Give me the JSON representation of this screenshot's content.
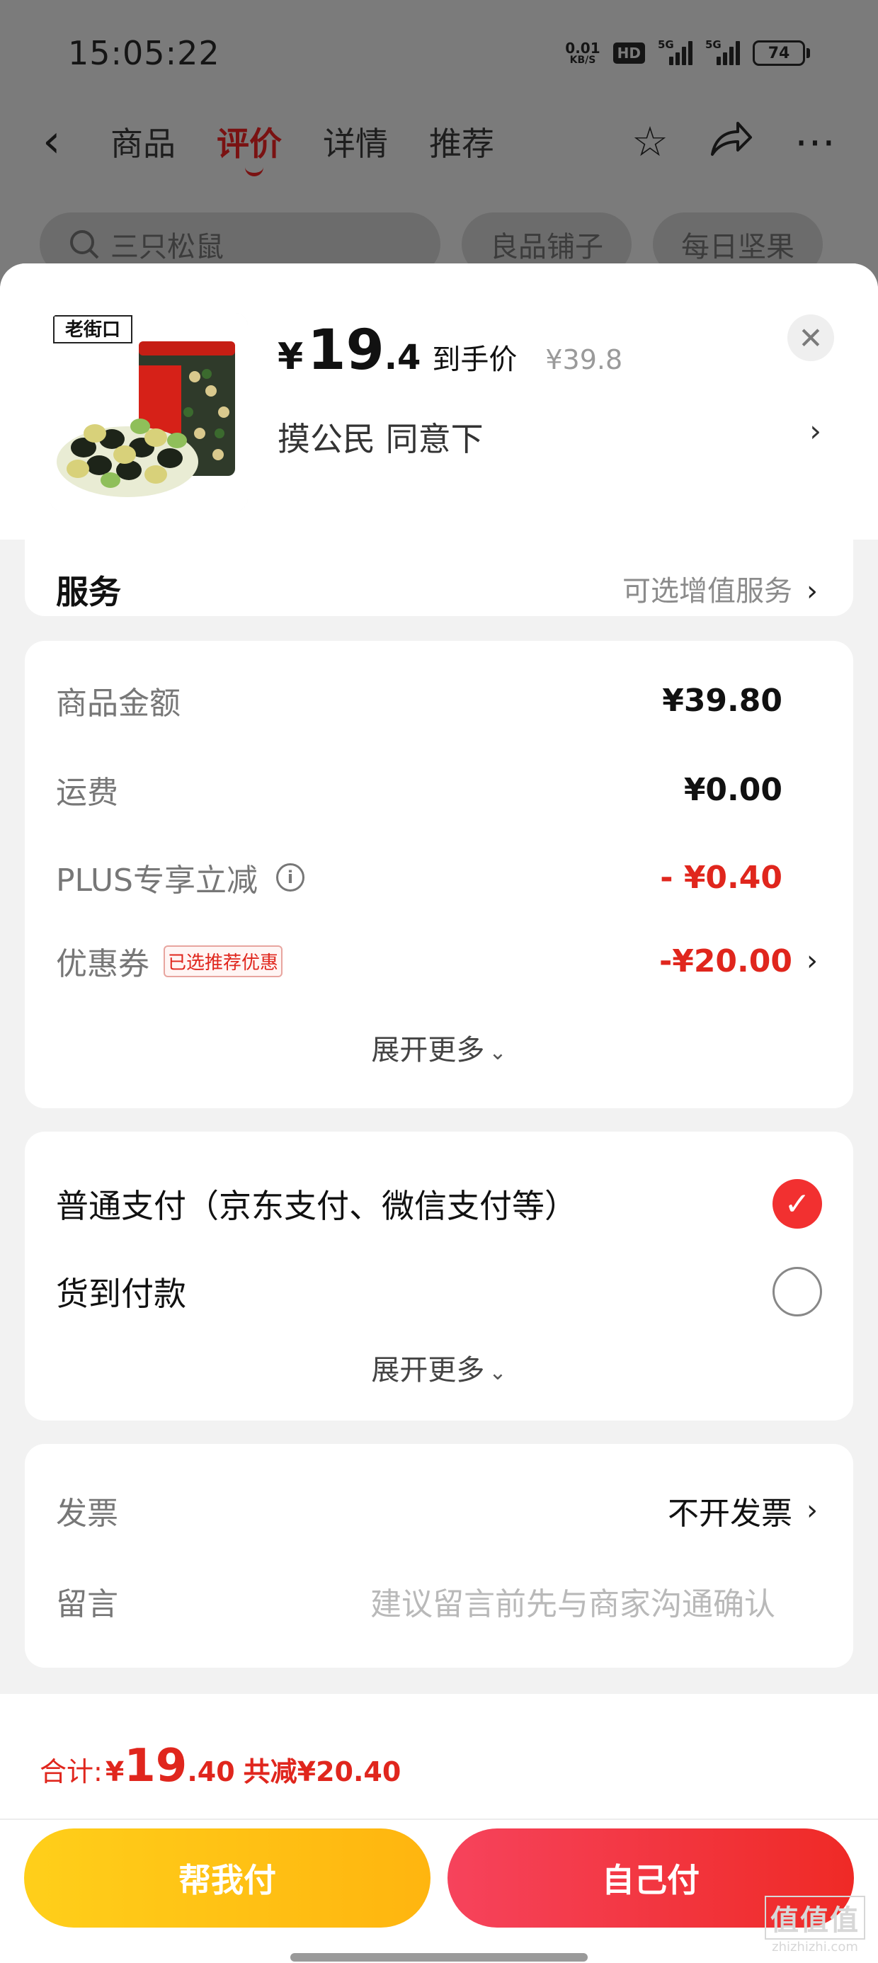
{
  "status": {
    "time": "15:05:22",
    "net_speed_value": "0.01",
    "net_speed_unit": "KB/S",
    "hd": "HD",
    "signal1_label": "5G",
    "signal2_label": "5G",
    "battery": "74"
  },
  "nav": {
    "tabs": [
      {
        "label": "商品"
      },
      {
        "label": "评价"
      },
      {
        "label": "详情"
      },
      {
        "label": "推荐"
      }
    ],
    "active_tab": "评价",
    "icons": [
      "back-icon",
      "star-icon",
      "share-icon",
      "more-icon"
    ]
  },
  "search_row": {
    "search_placeholder": "三只松鼠",
    "pill_1": "良品铺子",
    "pill_2": "每日坚果"
  },
  "product": {
    "brand": "老街口",
    "price_symbol": "¥",
    "price_int": "19",
    "price_dec": ".4",
    "price_tag": "到手价",
    "original_price": "¥39.8",
    "variant": "摸公民 同意下"
  },
  "service": {
    "label": "服务",
    "value": "可选增值服务"
  },
  "amounts": {
    "goods_label": "商品金额",
    "goods_value": "¥39.80",
    "shipping_label": "运费",
    "shipping_value": "¥0.00",
    "plus_label": "PLUS专享立减",
    "plus_value": "- ¥0.40",
    "coupon_label": "优惠券",
    "coupon_badge": "已选推荐优惠",
    "coupon_value": "-¥20.00",
    "expand": "展开更多"
  },
  "payment": {
    "option_1": "普通支付（京东支付、微信支付等）",
    "option_1_selected": true,
    "option_2": "货到付款",
    "option_2_selected": false,
    "expand": "展开更多"
  },
  "invoice": {
    "label": "发票",
    "value": "不开发票",
    "message_label": "留言",
    "message_placeholder": "建议留言前先与商家沟通确认"
  },
  "summary": {
    "total_label": "合计:",
    "total_symbol": "¥",
    "total_int": "19",
    "total_dec": ".40",
    "saved": "共减¥20.40",
    "help_pay_label": "帮我付",
    "self_pay_label": "自己付"
  },
  "watermark": {
    "top": "值值值",
    "bottom": "zhizhizhi.com"
  },
  "colors": {
    "accent_red": "#e0261d",
    "help_button": "#ffc21a",
    "self_button": "#f23535"
  }
}
